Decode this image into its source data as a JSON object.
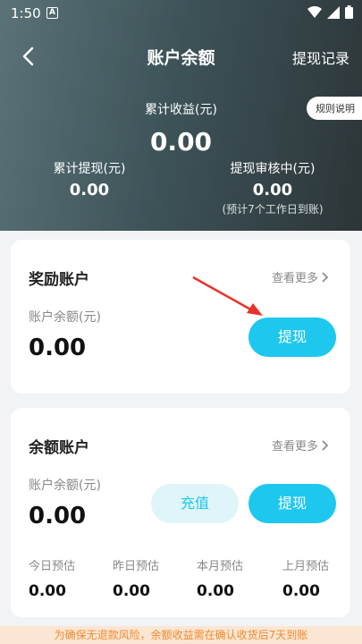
{
  "status": {
    "time": "1:50",
    "notification": "A"
  },
  "nav": {
    "title": "账户余额",
    "right_link": "提现记录"
  },
  "summary": {
    "total_label": "累计收益(元)",
    "total_value": "0.00",
    "rules_button": "规则说明",
    "withdrawn_label": "累计提现(元)",
    "withdrawn_value": "0.00",
    "reviewing_label": "提现审核中(元)",
    "reviewing_value": "0.00",
    "reviewing_note": "(预计7个工作日到账)"
  },
  "reward_account": {
    "title": "奖励账户",
    "more": "查看更多",
    "balance_label": "账户余额(元)",
    "balance_value": "0.00",
    "withdraw_button": "提现"
  },
  "balance_account": {
    "title": "余额账户",
    "more": "查看更多",
    "balance_label": "账户余额(元)",
    "balance_value": "0.00",
    "recharge_button": "充值",
    "withdraw_button": "提现",
    "estimates": [
      {
        "label": "今日预估",
        "value": "0.00"
      },
      {
        "label": "昨日预估",
        "value": "0.00"
      },
      {
        "label": "本月预估",
        "value": "0.00"
      },
      {
        "label": "上月预估",
        "value": "0.00"
      }
    ]
  },
  "footer_notice": "为确保无退款风险，余额收益需在确认收货后7天到账",
  "colors": {
    "accent": "#1ec7ee",
    "annotation_arrow": "#e8322b"
  }
}
